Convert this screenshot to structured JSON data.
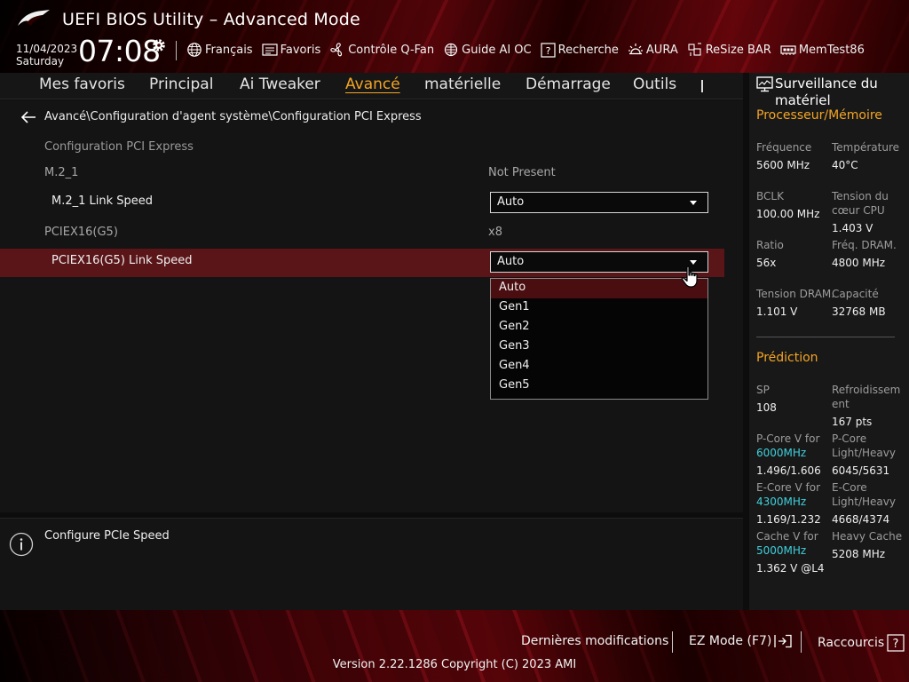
{
  "header": {
    "title": "UEFI BIOS Utility – Advanced Mode",
    "date": "11/04/2023",
    "day": "Saturday",
    "time": "07:08",
    "tools": [
      {
        "label": "Français",
        "icon": "globe-icon"
      },
      {
        "label": "Favoris",
        "icon": "favorites-list-icon"
      },
      {
        "label": "Contrôle Q-Fan",
        "icon": "fan-icon"
      },
      {
        "label": "Guide AI OC",
        "icon": "ai-oc-icon"
      },
      {
        "label": "Recherche",
        "icon": "help-search-icon"
      },
      {
        "label": "AURA",
        "icon": "aura-light-icon"
      },
      {
        "label": "ReSize BAR",
        "icon": "resize-bar-icon"
      },
      {
        "label": "MemTest86",
        "icon": "memory-icon"
      }
    ]
  },
  "nav": {
    "tabs": [
      "Mes favoris",
      "Principal",
      "Ai Tweaker",
      "Avancé",
      "matérielle",
      "Démarrage",
      "Outils"
    ],
    "active": "Avancé"
  },
  "main": {
    "breadcrumb": "Avancé\\Configuration d'agent système\\Configuration PCI Express",
    "section_title": "Configuration PCI Express",
    "rows": [
      {
        "label": "M.2_1",
        "value": "Not Present"
      },
      {
        "label": "M.2_1 Link Speed",
        "value": "Auto"
      },
      {
        "label": "PCIEX16(G5)",
        "value": "x8"
      },
      {
        "label": "PCIEX16(G5) Link Speed",
        "value": "Auto"
      }
    ],
    "dropdown_options": [
      "Auto",
      "Gen1",
      "Gen2",
      "Gen3",
      "Gen4",
      "Gen5"
    ],
    "dropdown_selected": "Auto"
  },
  "help": {
    "text": "Configure PCIe Speed"
  },
  "sidebar": {
    "title": "Surveillance du matériel",
    "section_cpu": "Processeur/Mémoire",
    "freq_label": "Fréquence",
    "freq_value": "5600 MHz",
    "temp_label": "Température",
    "temp_value": "40°C",
    "bclk_label": "BCLK",
    "bclk_value": "100.00 MHz",
    "core_v_label": "Tension du cœur CPU",
    "core_v_value": "1.403 V",
    "ratio_label": "Ratio",
    "ratio_value": "56x",
    "dram_freq_label": "Fréq. DRAM.",
    "dram_freq_value": "4800 MHz",
    "dram_v_label": "Tension DRAM.",
    "dram_v_value": "1.101 V",
    "capacity_label": "Capacité",
    "capacity_value": "32768 MB",
    "section_pred": "Prédiction",
    "sp_label": "SP",
    "sp_value": "108",
    "cooling_label": "Refroidissement",
    "cooling_value": "167 pts",
    "pcore_v_label": "P-Core V for",
    "pcore_v_freq": "6000MHz",
    "pcore_v_value": "1.496/1.606",
    "pcore_lh_label": "P-Core Light/Heavy",
    "pcore_lh_value": "6045/5631",
    "ecore_v_label": "E-Core V for",
    "ecore_v_freq": "4300MHz",
    "ecore_v_value": "1.169/1.232",
    "ecore_lh_label": "E-Core Light/Heavy",
    "ecore_lh_value": "4668/4374",
    "cache_v_label": "Cache V for",
    "cache_v_freq": "5000MHz",
    "cache_v_value": "1.362 V @L4",
    "heavy_cache_label": "Heavy Cache",
    "heavy_cache_value": "5208 MHz"
  },
  "footer": {
    "last_changes": "Dernières modifications",
    "ez_mode": "EZ Mode (F7)",
    "shortcuts": "Raccourcis",
    "version": "Version 2.22.1286 Copyright (C) 2023 AMI"
  },
  "colors": {
    "accent_orange": "#f4a524",
    "highlight_red": "#5a1518",
    "cyan": "#3fd0dc"
  }
}
